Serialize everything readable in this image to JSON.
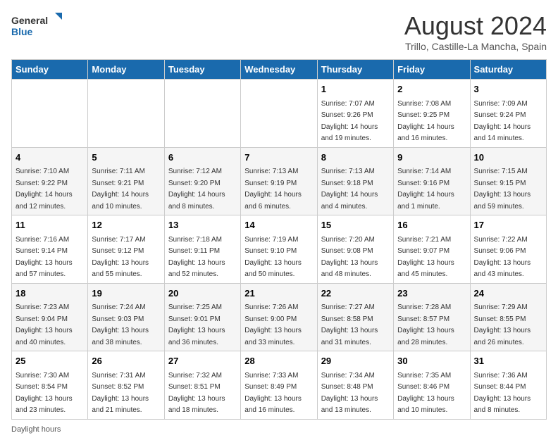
{
  "header": {
    "logo_general": "General",
    "logo_blue": "Blue",
    "title": "August 2024",
    "subtitle": "Trillo, Castille-La Mancha, Spain"
  },
  "days_of_week": [
    "Sunday",
    "Monday",
    "Tuesday",
    "Wednesday",
    "Thursday",
    "Friday",
    "Saturday"
  ],
  "weeks": [
    [
      {
        "day": "",
        "info": ""
      },
      {
        "day": "",
        "info": ""
      },
      {
        "day": "",
        "info": ""
      },
      {
        "day": "",
        "info": ""
      },
      {
        "day": "1",
        "info": "Sunrise: 7:07 AM\nSunset: 9:26 PM\nDaylight: 14 hours and 19 minutes."
      },
      {
        "day": "2",
        "info": "Sunrise: 7:08 AM\nSunset: 9:25 PM\nDaylight: 14 hours and 16 minutes."
      },
      {
        "day": "3",
        "info": "Sunrise: 7:09 AM\nSunset: 9:24 PM\nDaylight: 14 hours and 14 minutes."
      }
    ],
    [
      {
        "day": "4",
        "info": "Sunrise: 7:10 AM\nSunset: 9:22 PM\nDaylight: 14 hours and 12 minutes."
      },
      {
        "day": "5",
        "info": "Sunrise: 7:11 AM\nSunset: 9:21 PM\nDaylight: 14 hours and 10 minutes."
      },
      {
        "day": "6",
        "info": "Sunrise: 7:12 AM\nSunset: 9:20 PM\nDaylight: 14 hours and 8 minutes."
      },
      {
        "day": "7",
        "info": "Sunrise: 7:13 AM\nSunset: 9:19 PM\nDaylight: 14 hours and 6 minutes."
      },
      {
        "day": "8",
        "info": "Sunrise: 7:13 AM\nSunset: 9:18 PM\nDaylight: 14 hours and 4 minutes."
      },
      {
        "day": "9",
        "info": "Sunrise: 7:14 AM\nSunset: 9:16 PM\nDaylight: 14 hours and 1 minute."
      },
      {
        "day": "10",
        "info": "Sunrise: 7:15 AM\nSunset: 9:15 PM\nDaylight: 13 hours and 59 minutes."
      }
    ],
    [
      {
        "day": "11",
        "info": "Sunrise: 7:16 AM\nSunset: 9:14 PM\nDaylight: 13 hours and 57 minutes."
      },
      {
        "day": "12",
        "info": "Sunrise: 7:17 AM\nSunset: 9:12 PM\nDaylight: 13 hours and 55 minutes."
      },
      {
        "day": "13",
        "info": "Sunrise: 7:18 AM\nSunset: 9:11 PM\nDaylight: 13 hours and 52 minutes."
      },
      {
        "day": "14",
        "info": "Sunrise: 7:19 AM\nSunset: 9:10 PM\nDaylight: 13 hours and 50 minutes."
      },
      {
        "day": "15",
        "info": "Sunrise: 7:20 AM\nSunset: 9:08 PM\nDaylight: 13 hours and 48 minutes."
      },
      {
        "day": "16",
        "info": "Sunrise: 7:21 AM\nSunset: 9:07 PM\nDaylight: 13 hours and 45 minutes."
      },
      {
        "day": "17",
        "info": "Sunrise: 7:22 AM\nSunset: 9:06 PM\nDaylight: 13 hours and 43 minutes."
      }
    ],
    [
      {
        "day": "18",
        "info": "Sunrise: 7:23 AM\nSunset: 9:04 PM\nDaylight: 13 hours and 40 minutes."
      },
      {
        "day": "19",
        "info": "Sunrise: 7:24 AM\nSunset: 9:03 PM\nDaylight: 13 hours and 38 minutes."
      },
      {
        "day": "20",
        "info": "Sunrise: 7:25 AM\nSunset: 9:01 PM\nDaylight: 13 hours and 36 minutes."
      },
      {
        "day": "21",
        "info": "Sunrise: 7:26 AM\nSunset: 9:00 PM\nDaylight: 13 hours and 33 minutes."
      },
      {
        "day": "22",
        "info": "Sunrise: 7:27 AM\nSunset: 8:58 PM\nDaylight: 13 hours and 31 minutes."
      },
      {
        "day": "23",
        "info": "Sunrise: 7:28 AM\nSunset: 8:57 PM\nDaylight: 13 hours and 28 minutes."
      },
      {
        "day": "24",
        "info": "Sunrise: 7:29 AM\nSunset: 8:55 PM\nDaylight: 13 hours and 26 minutes."
      }
    ],
    [
      {
        "day": "25",
        "info": "Sunrise: 7:30 AM\nSunset: 8:54 PM\nDaylight: 13 hours and 23 minutes."
      },
      {
        "day": "26",
        "info": "Sunrise: 7:31 AM\nSunset: 8:52 PM\nDaylight: 13 hours and 21 minutes."
      },
      {
        "day": "27",
        "info": "Sunrise: 7:32 AM\nSunset: 8:51 PM\nDaylight: 13 hours and 18 minutes."
      },
      {
        "day": "28",
        "info": "Sunrise: 7:33 AM\nSunset: 8:49 PM\nDaylight: 13 hours and 16 minutes."
      },
      {
        "day": "29",
        "info": "Sunrise: 7:34 AM\nSunset: 8:48 PM\nDaylight: 13 hours and 13 minutes."
      },
      {
        "day": "30",
        "info": "Sunrise: 7:35 AM\nSunset: 8:46 PM\nDaylight: 13 hours and 10 minutes."
      },
      {
        "day": "31",
        "info": "Sunrise: 7:36 AM\nSunset: 8:44 PM\nDaylight: 13 hours and 8 minutes."
      }
    ]
  ],
  "footer": {
    "daylight_label": "Daylight hours"
  }
}
